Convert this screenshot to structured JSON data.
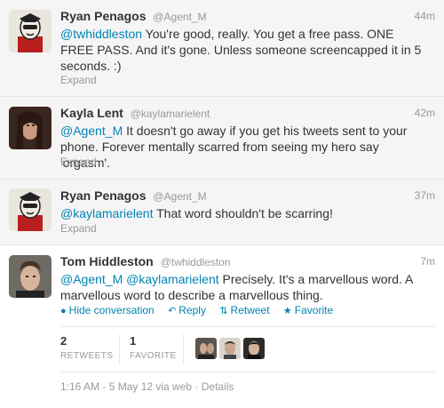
{
  "tweets": [
    {
      "fullname": "Ryan Penagos",
      "username": "@Agent_M",
      "time": "44m",
      "mentions": [
        "@twhiddleston"
      ],
      "text": " You're good, really. You get a free pass. ONE FREE PASS. And it's gone. Unless someone screencapped it in 5 seconds. :)",
      "expand": "Expand"
    },
    {
      "fullname": "Kayla Lent",
      "username": "@kaylamarielent",
      "time": "42m",
      "mentions": [
        "@Agent_M"
      ],
      "text": " It doesn't go away if you get his tweets sent to your phone. Forever mentally scarred from seeing my hero say 'orgasm'.",
      "expand": "Expand"
    },
    {
      "fullname": "Ryan Penagos",
      "username": "@Agent_M",
      "time": "37m",
      "mentions": [
        "@kaylamarielent"
      ],
      "text": " That word shouldn't be scarring!",
      "expand": "Expand"
    }
  ],
  "main_tweet": {
    "fullname": "Tom Hiddleston",
    "username": "@twhiddleston",
    "time": "7m",
    "mention1": "@Agent_M",
    "mention2": "@kaylamarielent",
    "text": " Precisely. It's a marvellous word. A marvellous word to describe a marvellous thing.",
    "actions": {
      "hide": "Hide conversation",
      "reply": "Reply",
      "retweet": "Retweet",
      "favorite": "Favorite"
    },
    "stats": {
      "retweets_count": "2",
      "retweets_label": "RETWEETS",
      "favorites_count": "1",
      "favorites_label": "FAVORITE"
    },
    "meta": "1:16 AM - 5 May 12 via web · Details"
  },
  "colors": {
    "link": "#0084b4",
    "muted": "#999999",
    "conversation_bg": "#f5f5f5"
  }
}
